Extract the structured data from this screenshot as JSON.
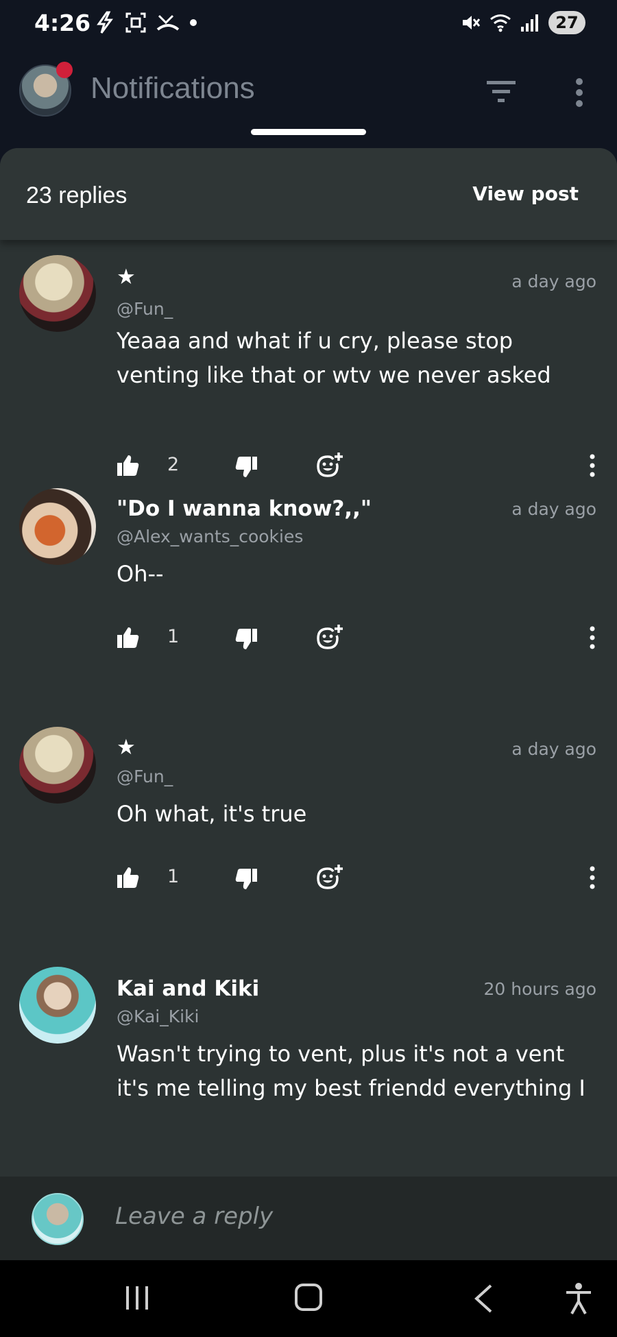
{
  "status_bar": {
    "time": "4:26",
    "battery": "27",
    "icons": [
      "flash-icon",
      "screenshot-icon",
      "missed-call-icon",
      "dot-icon",
      "mute-icon",
      "wifi-icon",
      "signal-icon",
      "battery-icon"
    ]
  },
  "header": {
    "title": "Notifications",
    "icons": [
      "avatar",
      "notification-dot",
      "filter-icon",
      "more-vert-icon"
    ]
  },
  "sheet": {
    "replies_count": "23 replies",
    "view_post": "View post"
  },
  "comments": [
    {
      "name": "★",
      "handle": "@Fun_",
      "time": "a day ago",
      "text": "Yeaaa and what if u cry, please stop venting like that or wtv we never asked",
      "likes": "2"
    },
    {
      "name": "\"Do I wanna know?,,\"",
      "handle": "@Alex_wants_cookies",
      "time": "a day ago",
      "text": "Oh--",
      "likes": "1"
    },
    {
      "name": "★",
      "handle": "@Fun_",
      "time": "a day ago",
      "text": "Oh what, it's true",
      "likes": "1"
    },
    {
      "name": "Kai and Kiki",
      "handle": "@Kai_Kiki",
      "time": "20 hours ago",
      "text": "Wasn't trying to vent, plus it's not a vent it's me telling my best friendd everything I",
      "likes": ""
    }
  ],
  "reply_bar": {
    "placeholder": "Leave a reply"
  },
  "colors": {
    "background": "#101520",
    "sheet": "#2c3333",
    "notification_dot": "#d0203a",
    "muted_text": "#9aa0a6"
  }
}
